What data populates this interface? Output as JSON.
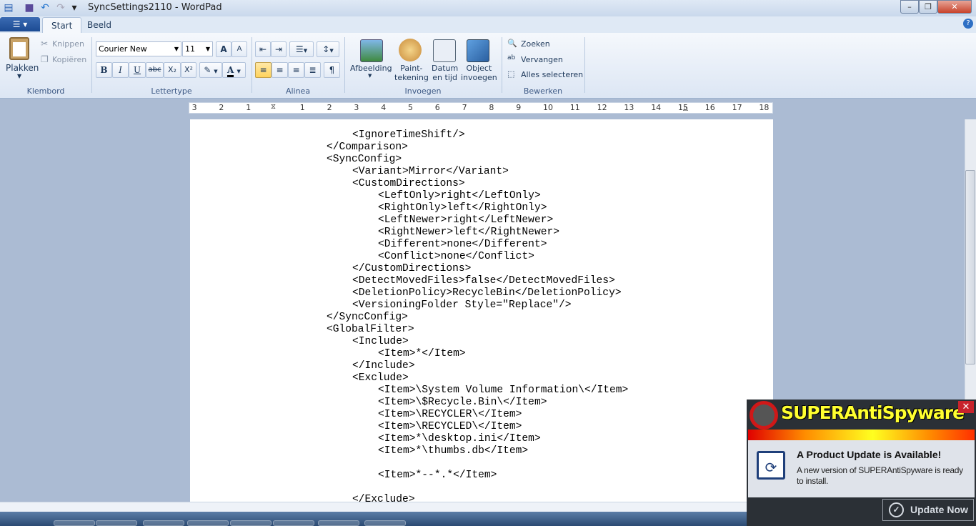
{
  "window": {
    "title": "SyncSettings2110 - WordPad",
    "min": "–",
    "max": "❐",
    "close": "✕"
  },
  "quick_access": {
    "save": "💾",
    "undo": "↶",
    "redo": "↷",
    "customize": "▾"
  },
  "tabs": [
    {
      "label": "Start"
    },
    {
      "label": "Beeld"
    }
  ],
  "help": "?",
  "ribbon": {
    "clipboard": {
      "group": "Klembord",
      "paste": "Plakken",
      "cut": "Knippen",
      "copy": "Kopiëren"
    },
    "font": {
      "group": "Lettertype",
      "family": "Courier New",
      "size": "11",
      "grow": "A",
      "shrink": "A",
      "bold": "B",
      "italic": "I",
      "underline": "U",
      "strike": "abc",
      "sub": "X₂",
      "sup": "X²",
      "highlight": "✎",
      "color": "A"
    },
    "paragraph": {
      "group": "Alinea"
    },
    "insert": {
      "group": "Invoegen",
      "picture": "Afbeelding",
      "paint": "Paint-\ntekening",
      "datetime": "Datum\nen tijd",
      "object": "Object\ninvoegen"
    },
    "edit": {
      "group": "Bewerken",
      "find": "Zoeken",
      "replace": "Vervangen",
      "select_all": "Alles selecteren"
    }
  },
  "ruler": {
    "ticks": [
      "3",
      "2",
      "1",
      "1",
      "2",
      "3",
      "4",
      "5",
      "6",
      "7",
      "8",
      "9",
      "10",
      "11",
      "12",
      "13",
      "14",
      "15",
      "16",
      "17",
      "18"
    ]
  },
  "document": {
    "lines": [
      {
        "indent": 2,
        "text": "<IgnoreTimeShift/>"
      },
      {
        "indent": 1,
        "text": "</Comparison>"
      },
      {
        "indent": 1,
        "text": "<SyncConfig>"
      },
      {
        "indent": 2,
        "text": "<Variant>Mirror</Variant>"
      },
      {
        "indent": 2,
        "text": "<CustomDirections>"
      },
      {
        "indent": 3,
        "text": "<LeftOnly>right</LeftOnly>"
      },
      {
        "indent": 3,
        "text": "<RightOnly>left</RightOnly>"
      },
      {
        "indent": 3,
        "text": "<LeftNewer>right</LeftNewer>"
      },
      {
        "indent": 3,
        "text": "<RightNewer>left</RightNewer>"
      },
      {
        "indent": 3,
        "text": "<Different>none</Different>"
      },
      {
        "indent": 3,
        "text": "<Conflict>none</Conflict>"
      },
      {
        "indent": 2,
        "text": "</CustomDirections>"
      },
      {
        "indent": 2,
        "text": "<DetectMovedFiles>false</DetectMovedFiles>"
      },
      {
        "indent": 2,
        "text": "<DeletionPolicy>RecycleBin</DeletionPolicy>"
      },
      {
        "indent": 2,
        "text": "<VersioningFolder Style=\"Replace\"/>"
      },
      {
        "indent": 1,
        "text": "</SyncConfig>"
      },
      {
        "indent": 1,
        "text": "<GlobalFilter>"
      },
      {
        "indent": 2,
        "text": "<Include>"
      },
      {
        "indent": 3,
        "text": "<Item>*</Item>"
      },
      {
        "indent": 2,
        "text": "</Include>"
      },
      {
        "indent": 2,
        "text": "<Exclude>"
      },
      {
        "indent": 3,
        "text": "<Item>\\System Volume Information\\</Item>"
      },
      {
        "indent": 3,
        "text": "<Item>\\$Recycle.Bin\\</Item>"
      },
      {
        "indent": 3,
        "text": "<Item>\\RECYCLER\\</Item>"
      },
      {
        "indent": 3,
        "text": "<Item>\\RECYCLED\\</Item>"
      },
      {
        "indent": 3,
        "text": "<Item>*\\desktop.ini</Item>"
      },
      {
        "indent": 3,
        "text": "<Item>*\\thumbs.db</Item>"
      },
      {
        "indent": 3,
        "text": ""
      },
      {
        "indent": 3,
        "text": "<Item>*--*.*</Item>"
      },
      {
        "indent": 3,
        "text": ""
      },
      {
        "indent": 2,
        "text": "</Exclude>"
      }
    ]
  },
  "popup": {
    "brand": "SUPERAntiSpyware",
    "close": "✕",
    "title": "A Product Update is Available!",
    "message": "A new version of SUPERAntiSpyware is ready to install.",
    "button": "Update Now"
  }
}
